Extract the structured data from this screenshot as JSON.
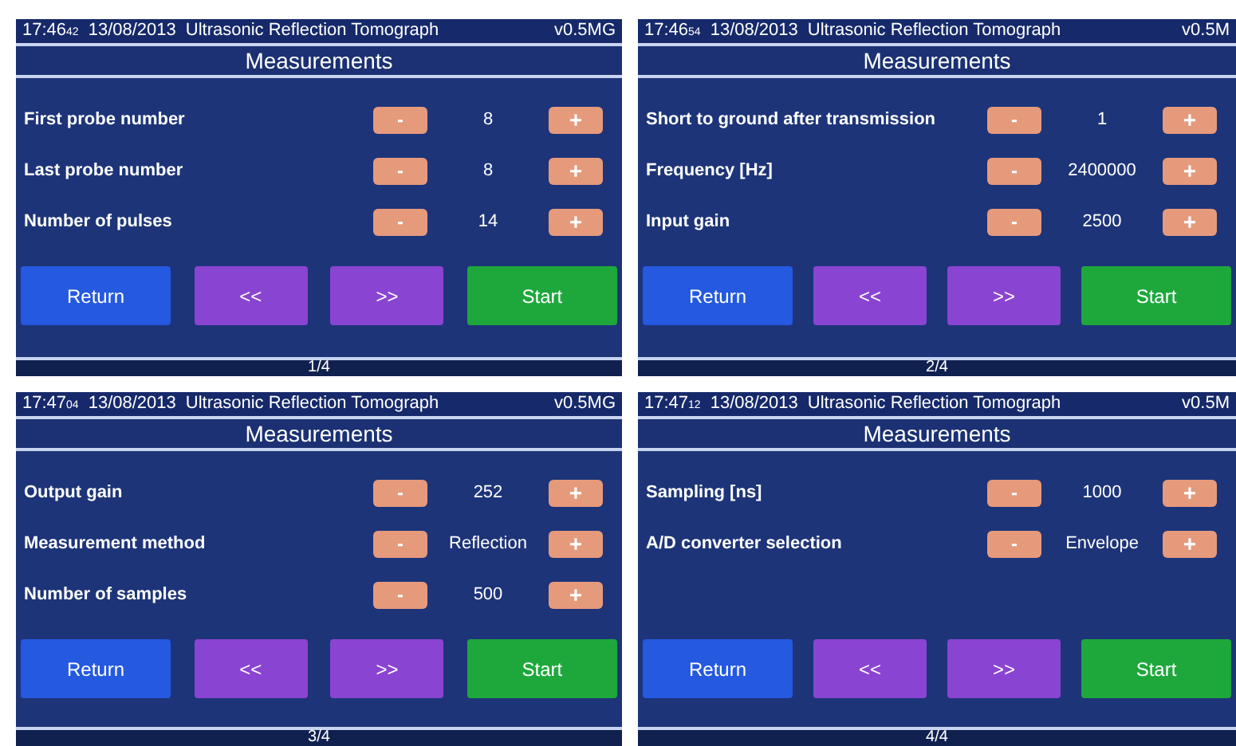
{
  "panels": [
    {
      "header": {
        "time": "17:46",
        "seconds": "42",
        "date": "13/08/2013",
        "title": "Ultrasonic Reflection Tomograph",
        "version": "v0.5MG"
      },
      "heading": "Measurements",
      "settings": [
        {
          "label": "First probe number",
          "decrement": "-",
          "value": "8",
          "increment": "+"
        },
        {
          "label": "Last probe number",
          "decrement": "-",
          "value": "8",
          "increment": "+"
        },
        {
          "label": "Number of pulses",
          "decrement": "-",
          "value": "14",
          "increment": "+"
        }
      ],
      "buttons": [
        {
          "kind": "return",
          "label": "Return"
        },
        {
          "kind": "prev",
          "label": "<<"
        },
        {
          "kind": "next",
          "label": ">>"
        },
        {
          "kind": "start",
          "label": "Start"
        }
      ],
      "page": "1/4"
    },
    {
      "header": {
        "time": "17:46",
        "seconds": "54",
        "date": "13/08/2013",
        "title": "Ultrasonic Reflection Tomograph",
        "version": "v0.5M"
      },
      "heading": "Measurements",
      "settings": [
        {
          "label": "Short to ground after transmission",
          "decrement": "-",
          "value": "1",
          "increment": "+"
        },
        {
          "label": "Frequency [Hz]",
          "decrement": "-",
          "value": "2400000",
          "increment": "+"
        },
        {
          "label": "Input gain",
          "decrement": "-",
          "value": "2500",
          "increment": "+"
        }
      ],
      "buttons": [
        {
          "kind": "return",
          "label": "Return"
        },
        {
          "kind": "prev",
          "label": "<<"
        },
        {
          "kind": "next",
          "label": ">>"
        },
        {
          "kind": "start",
          "label": "Start"
        }
      ],
      "page": "2/4"
    },
    {
      "header": {
        "time": "17:47",
        "seconds": "04",
        "date": "13/08/2013",
        "title": "Ultrasonic Reflection Tomograph",
        "version": "v0.5MG"
      },
      "heading": "Measurements",
      "settings": [
        {
          "label": "Output gain",
          "decrement": "-",
          "value": "252",
          "increment": "+"
        },
        {
          "label": "Measurement method",
          "decrement": "-",
          "value": "Reflection",
          "increment": "+"
        },
        {
          "label": "Number of samples",
          "decrement": "-",
          "value": "500",
          "increment": "+"
        }
      ],
      "buttons": [
        {
          "kind": "return",
          "label": "Return"
        },
        {
          "kind": "prev",
          "label": "<<"
        },
        {
          "kind": "next",
          "label": ">>"
        },
        {
          "kind": "start",
          "label": "Start"
        }
      ],
      "page": "3/4"
    },
    {
      "header": {
        "time": "17:47",
        "seconds": "12",
        "date": "13/08/2013",
        "title": "Ultrasonic Reflection Tomograph",
        "version": "v0.5M"
      },
      "heading": "Measurements",
      "settings": [
        {
          "label": "Sampling [ns]",
          "decrement": "-",
          "value": "1000",
          "increment": "+"
        },
        {
          "label": "A/D converter selection",
          "decrement": "-",
          "value": "Envelope",
          "increment": "+"
        }
      ],
      "buttons": [
        {
          "kind": "return",
          "label": "Return"
        },
        {
          "kind": "prev",
          "label": "<<"
        },
        {
          "kind": "next",
          "label": ">>"
        },
        {
          "kind": "start",
          "label": "Start"
        }
      ],
      "page": "4/4"
    }
  ]
}
